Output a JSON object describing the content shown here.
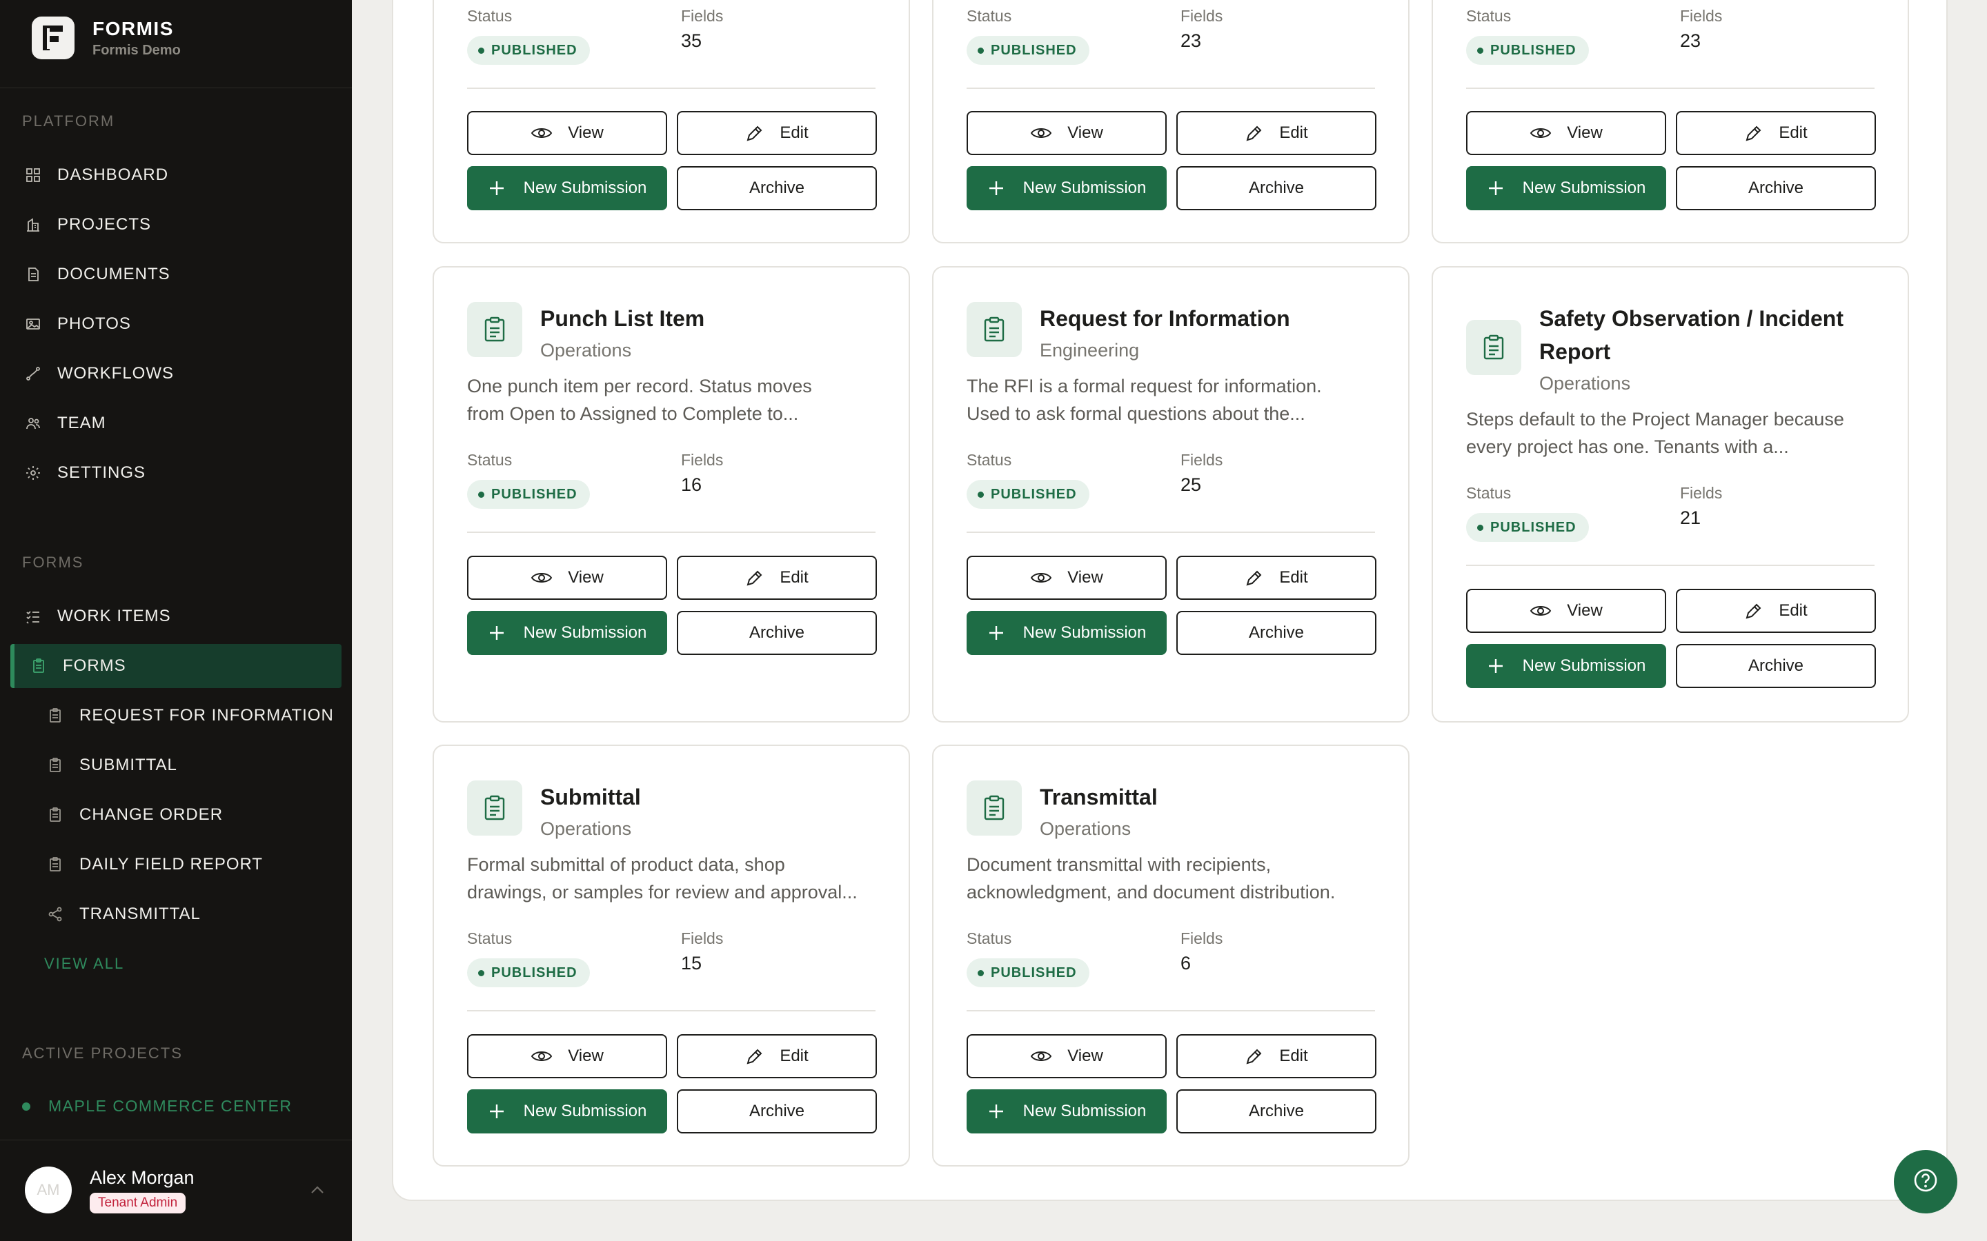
{
  "brand": {
    "name": "FORMIS",
    "subtitle": "Formis Demo",
    "logo_letter": "F"
  },
  "sidebar": {
    "platform_label": "PLATFORM",
    "platform_items": [
      {
        "label": "DASHBOARD",
        "icon": "grid-icon"
      },
      {
        "label": "PROJECTS",
        "icon": "building-icon"
      },
      {
        "label": "DOCUMENTS",
        "icon": "document-icon"
      },
      {
        "label": "PHOTOS",
        "icon": "photo-icon"
      },
      {
        "label": "WORKFLOWS",
        "icon": "workflow-icon"
      },
      {
        "label": "TEAM",
        "icon": "team-icon"
      },
      {
        "label": "SETTINGS",
        "icon": "gear-icon"
      }
    ],
    "forms_label": "FORMS",
    "forms_items": [
      {
        "label": "WORK ITEMS",
        "icon": "checklist-icon"
      },
      {
        "label": "FORMS",
        "icon": "clipboard-icon",
        "active": true
      },
      {
        "label": "REQUEST FOR INFORMATION",
        "icon": "clipboard-icon"
      },
      {
        "label": "SUBMITTAL",
        "icon": "clipboard-icon"
      },
      {
        "label": "CHANGE ORDER",
        "icon": "clipboard-icon"
      },
      {
        "label": "DAILY FIELD REPORT",
        "icon": "clipboard-icon"
      },
      {
        "label": "TRANSMITTAL",
        "icon": "share-icon"
      }
    ],
    "view_all": "VIEW ALL",
    "active_projects_label": "ACTIVE PROJECTS",
    "projects": [
      {
        "label": "MAPLE COMMERCE CENTER"
      }
    ],
    "user": {
      "name": "Alex Morgan",
      "initials": "AM",
      "role": "Tenant Admin"
    }
  },
  "labels": {
    "status": "Status",
    "fields": "Fields",
    "view": "View",
    "edit": "Edit",
    "new_submission": "New Submission",
    "archive": "Archive"
  },
  "cards": [
    {
      "status": "PUBLISHED",
      "fields": "35"
    },
    {
      "status": "PUBLISHED",
      "fields": "23"
    },
    {
      "status": "PUBLISHED",
      "fields": "23"
    },
    {
      "title": "Punch List Item",
      "category": "Operations",
      "description": [
        "One punch item per record. Status moves",
        "from Open to Assigned to Complete to..."
      ],
      "status": "PUBLISHED",
      "fields": "16"
    },
    {
      "title": "Request for Information",
      "category": "Engineering",
      "description": [
        "The RFI is a formal request for information.",
        "Used to ask formal questions about the..."
      ],
      "status": "PUBLISHED",
      "fields": "25"
    },
    {
      "title_lines": [
        "Safety Observation / Incident",
        "Report"
      ],
      "category": "Operations",
      "description": [
        "Steps default to the Project Manager because",
        "every project has one. Tenants with a..."
      ],
      "status": "PUBLISHED",
      "fields": "21"
    },
    {
      "title": "Submittal",
      "category": "Operations",
      "description": [
        "Formal submittal of product data, shop",
        "drawings, or samples for review and approval..."
      ],
      "status": "PUBLISHED",
      "fields": "15"
    },
    {
      "title": "Transmittal",
      "category": "Operations",
      "description": [
        "Document transmittal with recipients,",
        "acknowledgment, and document distribution."
      ],
      "status": "PUBLISHED",
      "fields": "6"
    }
  ],
  "colors": {
    "accent": "#1e6c45",
    "sidebar_bg": "#151412",
    "badge_bg": "#e8f2ec",
    "role_badge": "#c2223b"
  }
}
